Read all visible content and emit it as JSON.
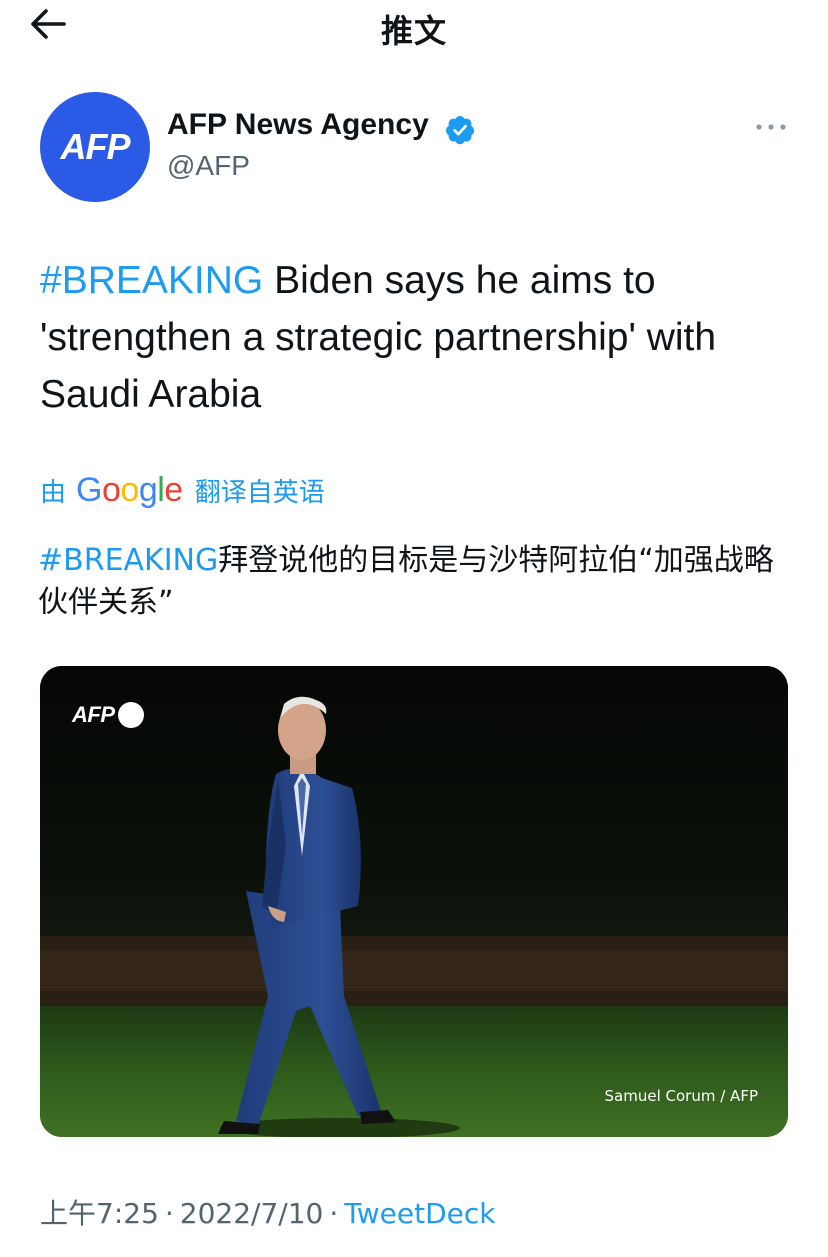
{
  "header": {
    "title": "推文",
    "back_icon": "arrow-left-icon"
  },
  "author": {
    "name": "AFP News Agency",
    "handle": "@AFP",
    "avatar_text": "AFP",
    "avatar_color": "#2b5be6",
    "verified": true,
    "verified_color": "#1d9bf0"
  },
  "tweet": {
    "hashtag": "#BREAKING",
    "text": " Biden says he aims to 'strengthen a strategic partnership' with Saudi Arabia"
  },
  "translation": {
    "by_label": "由",
    "provider": "Google",
    "from_label": "翻译自英语",
    "hashtag": "#BREAKING",
    "text": "拜登说他的目标是与沙特阿拉伯“加强战略伙伴关系”"
  },
  "media": {
    "watermark": "AFP",
    "credit": "Samuel Corum / AFP"
  },
  "meta": {
    "time": "上午7:25",
    "separator": "·",
    "date": "2022/7/10",
    "source": "TweetDeck"
  },
  "colors": {
    "accent": "#1d9bf0",
    "text": "#0f1419",
    "secondary": "#536471"
  }
}
